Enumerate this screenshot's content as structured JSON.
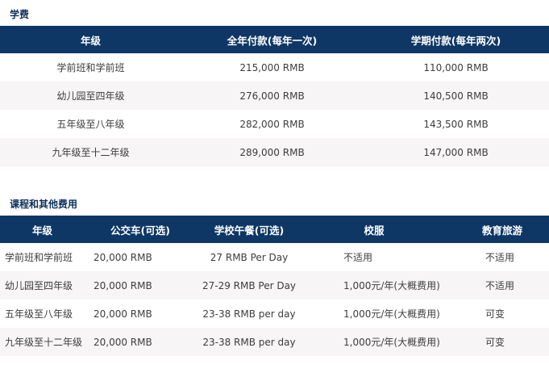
{
  "tuition": {
    "title": "学费",
    "headers": [
      "年级",
      "全年付款(每年一次)",
      "学期付款(每年两次)"
    ],
    "rows": [
      [
        "学前班和学前班",
        "215,000 RMB",
        "110,000 RMB"
      ],
      [
        "幼儿园至四年级",
        "276,000 RMB",
        "140,500 RMB"
      ],
      [
        "五年级至八年级",
        "282,000 RMB",
        "143,500 RMB"
      ],
      [
        "九年级至十二年级",
        "289,000 RMB",
        "147,000 RMB"
      ]
    ]
  },
  "other_fees": {
    "title": "课程和其他费用",
    "headers": [
      "年级",
      "公交车(可选)",
      "学校午餐(可选)",
      "校服",
      "教育旅游"
    ],
    "rows": [
      [
        "学前班和学前班",
        "20,000 RMB",
        "27 RMB Per Day",
        "不适用",
        "不适用"
      ],
      [
        "幼儿园至四年级",
        "20,000 RMB",
        "27-29 RMB Per Day",
        "1,000元/年(大概费用)",
        "不适用"
      ],
      [
        "五年级至八年级",
        "20,000 RMB",
        "23-38 RMB per day",
        "1,000元/年(大概费用)",
        "可变"
      ],
      [
        "九年级至十二年级",
        "20,000 RMB",
        "23-38 RMB per day",
        "1,000元/年(大概费用)",
        "可变"
      ]
    ]
  }
}
